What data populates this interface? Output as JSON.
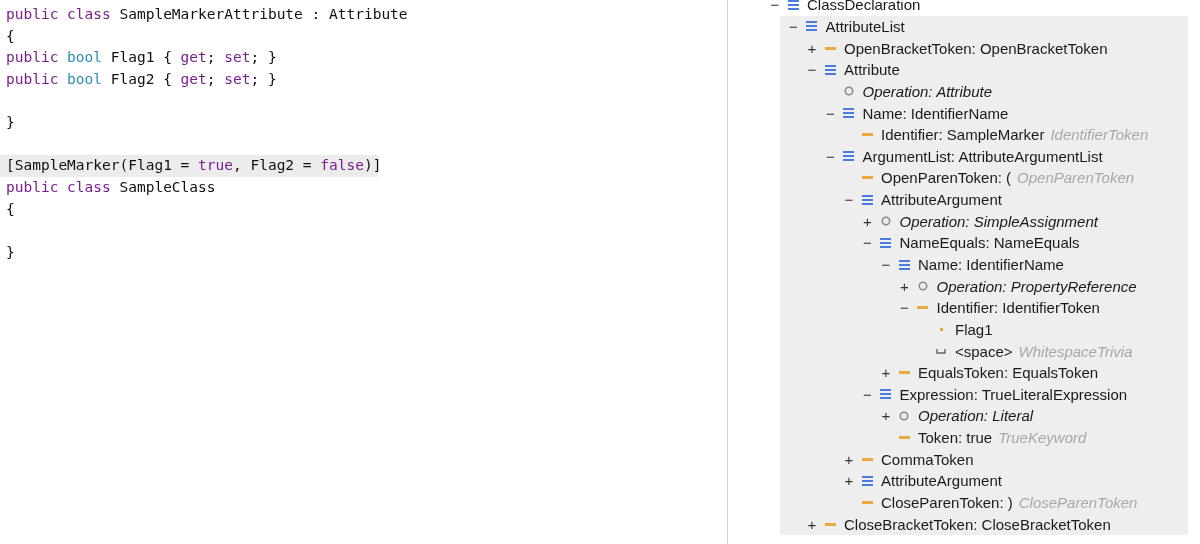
{
  "editor": {
    "lines": [
      {
        "highlighted": false,
        "tokens": [
          {
            "kind": "keyword",
            "text": "public "
          },
          {
            "kind": "keyword",
            "text": "class"
          },
          {
            "kind": "plain",
            "text": " SampleMarkerAttribute : Attribute"
          }
        ]
      },
      {
        "highlighted": false,
        "tokens": [
          {
            "kind": "plain",
            "text": "{"
          }
        ]
      },
      {
        "highlighted": false,
        "tokens": [
          {
            "kind": "keyword",
            "text": "public "
          },
          {
            "kind": "type",
            "text": "bool"
          },
          {
            "kind": "plain",
            "text": " Flag1 { "
          },
          {
            "kind": "keyword",
            "text": "get"
          },
          {
            "kind": "plain",
            "text": "; "
          },
          {
            "kind": "keyword",
            "text": "set"
          },
          {
            "kind": "plain",
            "text": "; }"
          }
        ]
      },
      {
        "highlighted": false,
        "tokens": [
          {
            "kind": "keyword",
            "text": "public "
          },
          {
            "kind": "type",
            "text": "bool"
          },
          {
            "kind": "plain",
            "text": " Flag2 { "
          },
          {
            "kind": "keyword",
            "text": "get"
          },
          {
            "kind": "plain",
            "text": "; "
          },
          {
            "kind": "keyword",
            "text": "set"
          },
          {
            "kind": "plain",
            "text": "; }"
          }
        ]
      },
      {
        "highlighted": false
      },
      {
        "highlighted": false,
        "tokens": [
          {
            "kind": "plain",
            "text": "}"
          }
        ]
      },
      {
        "highlighted": false
      },
      {
        "highlighted": true,
        "tokens": [
          {
            "kind": "plain",
            "text": "[SampleMarker(Flag1 = "
          },
          {
            "kind": "keyword",
            "text": "true"
          },
          {
            "kind": "plain",
            "text": ", Flag2 = "
          },
          {
            "kind": "keyword",
            "text": "false"
          },
          {
            "kind": "plain",
            "text": ")]"
          }
        ]
      },
      {
        "highlighted": false,
        "tokens": [
          {
            "kind": "keyword",
            "text": "public "
          },
          {
            "kind": "keyword",
            "text": "class"
          },
          {
            "kind": "plain",
            "text": " SampleClass"
          }
        ]
      },
      {
        "highlighted": false,
        "tokens": [
          {
            "kind": "plain",
            "text": "{"
          }
        ]
      },
      {
        "highlighted": false
      },
      {
        "highlighted": false,
        "tokens": [
          {
            "kind": "plain",
            "text": "}"
          }
        ]
      }
    ]
  },
  "tree": [
    {
      "toggle": "−",
      "kind": "list",
      "label": "ClassDeclaration",
      "selected": false,
      "children": [
        {
          "toggle": "−",
          "kind": "list",
          "label": "AttributeList",
          "selected": true,
          "children": [
            {
              "toggle": "+",
              "kind": "token",
              "label": "OpenBracketToken: OpenBracketToken",
              "selected": false
            },
            {
              "toggle": "−",
              "kind": "list",
              "label": "Attribute",
              "selected": false,
              "children": [
                {
                  "kind": "operation",
                  "label": "Operation: Attribute",
                  "selected": false
                },
                {
                  "toggle": "−",
                  "kind": "list",
                  "label": "Name: IdentifierName",
                  "selected": false,
                  "children": [
                    {
                      "kind": "token",
                      "label": "Identifier: SampleMarker",
                      "type": "IdentifierToken",
                      "selected": false
                    }
                  ]
                },
                {
                  "toggle": "−",
                  "kind": "list",
                  "label": "ArgumentList: AttributeArgumentList",
                  "selected": false,
                  "children": [
                    {
                      "kind": "token",
                      "label": "OpenParenToken: (",
                      "type": "OpenParenToken",
                      "selected": false
                    },
                    {
                      "toggle": "−",
                      "kind": "list",
                      "label": "AttributeArgument",
                      "selected": false,
                      "children": [
                        {
                          "toggle": "+",
                          "kind": "operation",
                          "label": "Operation: SimpleAssignment",
                          "selected": false
                        },
                        {
                          "toggle": "−",
                          "kind": "list",
                          "label": "NameEquals: NameEquals",
                          "selected": false,
                          "children": [
                            {
                              "toggle": "−",
                              "kind": "list",
                              "label": "Name: IdentifierName",
                              "selected": false,
                              "children": [
                                {
                                  "toggle": "+",
                                  "kind": "operation",
                                  "label": "Operation: PropertyReference",
                                  "selected": false
                                },
                                {
                                  "toggle": "−",
                                  "kind": "token",
                                  "label": "Identifier: IdentifierToken",
                                  "selected": false,
                                  "children": [
                                    {
                                      "kind": "text",
                                      "label": "Flag1",
                                      "selected": false
                                    },
                                    {
                                      "kind": "trivia",
                                      "label": "<space>",
                                      "type": "WhitespaceTrivia",
                                      "selected": false
                                    }
                                  ]
                                }
                              ]
                            },
                            {
                              "toggle": "+",
                              "kind": "token",
                              "label": "EqualsToken: EqualsToken",
                              "selected": false
                            }
                          ]
                        },
                        {
                          "toggle": "−",
                          "kind": "list",
                          "label": "Expression: TrueLiteralExpression",
                          "selected": false,
                          "children": [
                            {
                              "toggle": "+",
                              "kind": "operation",
                              "label": "Operation: Literal",
                              "selected": false
                            },
                            {
                              "kind": "token",
                              "label": "Token: true",
                              "type": "TrueKeyword",
                              "selected": false
                            }
                          ]
                        }
                      ]
                    },
                    {
                      "toggle": "+",
                      "kind": "token",
                      "label": "CommaToken",
                      "selected": false
                    },
                    {
                      "toggle": "+",
                      "kind": "list",
                      "label": "AttributeArgument",
                      "selected": false
                    },
                    {
                      "kind": "token",
                      "label": "CloseParenToken: )",
                      "type": "CloseParenToken",
                      "selected": false
                    }
                  ]
                }
              ]
            },
            {
              "toggle": "+",
              "kind": "token",
              "label": "CloseBracketToken: CloseBracketToken",
              "selected": false
            }
          ]
        }
      ]
    }
  ]
}
